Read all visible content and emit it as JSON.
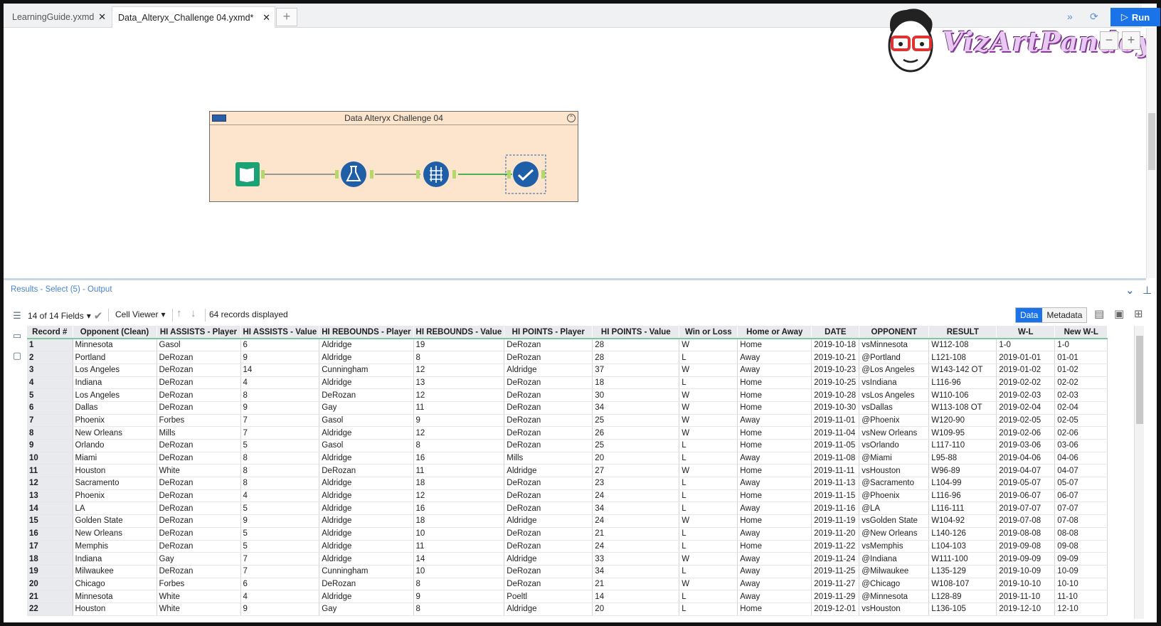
{
  "tabs": [
    {
      "label": "LearningGuide.yxmd",
      "close": "✕"
    },
    {
      "label": "Data_Alteryx_Challenge 04.yxmd*",
      "close": "✕"
    }
  ],
  "tab_add": "+",
  "run_label": "Run",
  "logo_text": "VizArtPandey",
  "container_title": "Data Alteryx Challenge 04",
  "results_title": "Results - Select (5) - Output",
  "toolbar": {
    "fields": "14 of 14 Fields",
    "viewer": "Cell Viewer",
    "records": "64 records displayed",
    "data_tab": "Data",
    "metadata_tab": "Metadata"
  },
  "colors": {
    "accent": "#1a73e8",
    "container_bg": "#fde5cd",
    "tool_blue": "#1f5fa8",
    "input_green": "#1aa174"
  },
  "columns": [
    "Record #",
    "Opponent (Clean)",
    "HI ASSISTS - Player",
    "HI ASSISTS - Value",
    "HI REBOUNDS - Player",
    "HI REBOUNDS - Value",
    "HI POINTS - Player",
    "HI POINTS - Value",
    "Win or Loss",
    "Home or Away",
    "DATE",
    "OPPONENT",
    "RESULT",
    "W-L",
    "New W-L"
  ],
  "rows": [
    [
      "1",
      "Minnesota",
      "Gasol",
      "6",
      "Aldridge",
      "19",
      "DeRozan",
      "28",
      "W",
      "Home",
      "2019-10-18",
      "vsMinnesota",
      "W112-108",
      "1-0",
      "1-0"
    ],
    [
      "2",
      "Portland",
      "DeRozan",
      "9",
      "Aldridge",
      "8",
      "DeRozan",
      "28",
      "L",
      "Away",
      "2019-10-21",
      "@Portland",
      "L121-108",
      "2019-01-01",
      "01-01"
    ],
    [
      "3",
      "Los Angeles",
      "DeRozan",
      "14",
      "Cunningham",
      "12",
      "Aldridge",
      "37",
      "W",
      "Away",
      "2019-10-23",
      "@Los Angeles",
      "W143-142 OT",
      "2019-01-02",
      "01-02"
    ],
    [
      "4",
      "Indiana",
      "DeRozan",
      "4",
      "Aldridge",
      "13",
      "DeRozan",
      "18",
      "L",
      "Home",
      "2019-10-25",
      "vsIndiana",
      "L116-96",
      "2019-02-02",
      "02-02"
    ],
    [
      "5",
      "Los Angeles",
      "DeRozan",
      "8",
      "DeRozan",
      "12",
      "DeRozan",
      "30",
      "W",
      "Home",
      "2019-10-28",
      "vsLos Angeles",
      "W110-106",
      "2019-02-03",
      "02-03"
    ],
    [
      "6",
      "Dallas",
      "DeRozan",
      "9",
      "Gay",
      "11",
      "DeRozan",
      "34",
      "W",
      "Home",
      "2019-10-30",
      "vsDallas",
      "W113-108 OT",
      "2019-02-04",
      "02-04"
    ],
    [
      "7",
      "Phoenix",
      "Forbes",
      "7",
      "Gasol",
      "9",
      "DeRozan",
      "25",
      "W",
      "Away",
      "2019-11-01",
      "@Phoenix",
      "W120-90",
      "2019-02-05",
      "02-05"
    ],
    [
      "8",
      "New Orleans",
      "Mills",
      "7",
      "Aldridge",
      "12",
      "DeRozan",
      "26",
      "W",
      "Home",
      "2019-11-04",
      "vsNew Orleans",
      "W109-95",
      "2019-02-06",
      "02-06"
    ],
    [
      "9",
      "Orlando",
      "DeRozan",
      "5",
      "Gasol",
      "8",
      "DeRozan",
      "25",
      "L",
      "Home",
      "2019-11-05",
      "vsOrlando",
      "L117-110",
      "2019-03-06",
      "03-06"
    ],
    [
      "10",
      "Miami",
      "DeRozan",
      "8",
      "Aldridge",
      "16",
      "Mills",
      "20",
      "L",
      "Away",
      "2019-11-08",
      "@Miami",
      "L95-88",
      "2019-04-06",
      "04-06"
    ],
    [
      "11",
      "Houston",
      "White",
      "8",
      "DeRozan",
      "11",
      "Aldridge",
      "27",
      "W",
      "Home",
      "2019-11-11",
      "vsHouston",
      "W96-89",
      "2019-04-07",
      "04-07"
    ],
    [
      "12",
      "Sacramento",
      "DeRozan",
      "8",
      "Aldridge",
      "18",
      "DeRozan",
      "23",
      "L",
      "Away",
      "2019-11-13",
      "@Sacramento",
      "L104-99",
      "2019-05-07",
      "05-07"
    ],
    [
      "13",
      "Phoenix",
      "DeRozan",
      "4",
      "Aldridge",
      "12",
      "DeRozan",
      "24",
      "L",
      "Home",
      "2019-11-15",
      "@Phoenix",
      "L116-96",
      "2019-06-07",
      "06-07"
    ],
    [
      "14",
      "LA",
      "DeRozan",
      "5",
      "Aldridge",
      "16",
      "DeRozan",
      "34",
      "L",
      "Away",
      "2019-11-16",
      "@LA",
      "L116-111",
      "2019-07-07",
      "07-07"
    ],
    [
      "15",
      "Golden State",
      "DeRozan",
      "9",
      "Aldridge",
      "18",
      "Aldridge",
      "24",
      "W",
      "Home",
      "2019-11-19",
      "vsGolden State",
      "W104-92",
      "2019-07-08",
      "07-08"
    ],
    [
      "16",
      "New Orleans",
      "DeRozan",
      "5",
      "Aldridge",
      "10",
      "DeRozan",
      "21",
      "L",
      "Away",
      "2019-11-20",
      "@New Orleans",
      "L140-126",
      "2019-08-08",
      "08-08"
    ],
    [
      "17",
      "Memphis",
      "DeRozan",
      "5",
      "Aldridge",
      "11",
      "DeRozan",
      "24",
      "L",
      "Home",
      "2019-11-22",
      "vsMemphis",
      "L104-103",
      "2019-09-08",
      "09-08"
    ],
    [
      "18",
      "Indiana",
      "Gay",
      "7",
      "Aldridge",
      "14",
      "Aldridge",
      "33",
      "W",
      "Away",
      "2019-11-24",
      "@Indiana",
      "W111-100",
      "2019-09-09",
      "09-09"
    ],
    [
      "19",
      "Milwaukee",
      "DeRozan",
      "7",
      "Cunningham",
      "10",
      "DeRozan",
      "34",
      "L",
      "Away",
      "2019-11-25",
      "@Milwaukee",
      "L135-129",
      "2019-10-09",
      "10-09"
    ],
    [
      "20",
      "Chicago",
      "Forbes",
      "6",
      "DeRozan",
      "8",
      "DeRozan",
      "21",
      "W",
      "Away",
      "2019-11-27",
      "@Chicago",
      "W108-107",
      "2019-10-10",
      "10-10"
    ],
    [
      "21",
      "Minnesota",
      "White",
      "4",
      "Aldridge",
      "9",
      "Poeltl",
      "14",
      "L",
      "Away",
      "2019-11-29",
      "@Minnesota",
      "L128-89",
      "2019-11-10",
      "11-10"
    ],
    [
      "22",
      "Houston",
      "White",
      "9",
      "Gay",
      "8",
      "Aldridge",
      "20",
      "L",
      "Home",
      "2019-12-01",
      "vsHouston",
      "L136-105",
      "2019-12-10",
      "12-10"
    ]
  ]
}
